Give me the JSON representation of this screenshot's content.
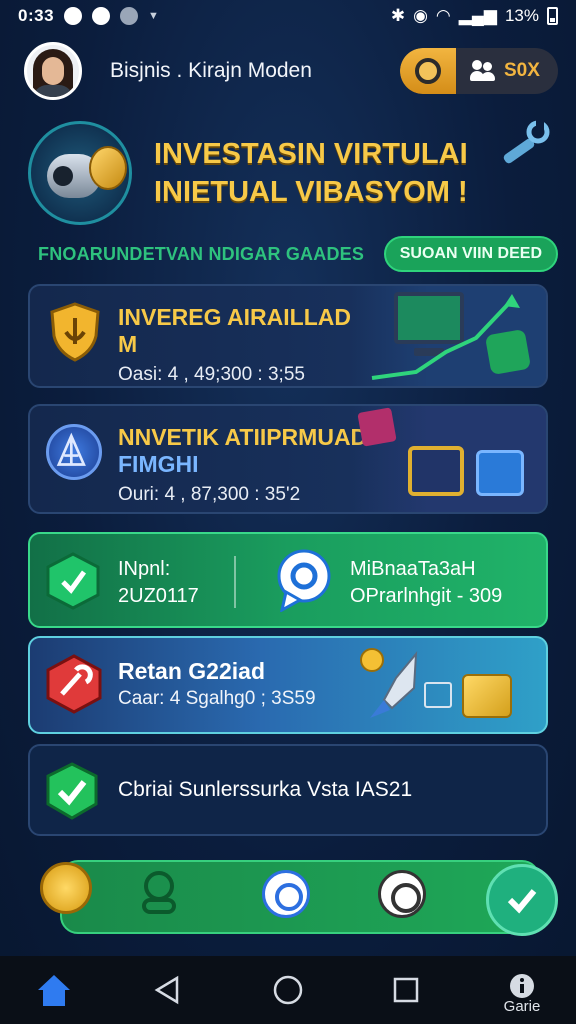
{
  "status_bar": {
    "time": "0:33",
    "battery": "13%"
  },
  "header": {
    "user_name": "Bisjnis . Kirajn Moden",
    "users_value": "S0X"
  },
  "hero": {
    "title_line1": "INVESTASIN VIRTULAI",
    "title_line2": "INIETUAL VIBASYOM !"
  },
  "subline": {
    "text": "FNOARUNDETVAN NDIGAR GAADES",
    "button": "SUOAN VIIN DEED"
  },
  "cards": [
    {
      "title_line1": "INVEREG AIRAILLAD",
      "title_line2": "M",
      "sub": "Oasi: 4 , 49;300 : 3;55"
    },
    {
      "title_line1": "NNVETIK ATIIPRMUAD",
      "title_line2": "FIMGHI",
      "sub": "Ouri: 4 , 87,300 : 35'2"
    }
  ],
  "split_card": {
    "left_line1": "INpnl:",
    "left_line2": "2UZ0117",
    "right_line1": "MiBnaaTa3aH",
    "right_line2": "OPrarlnhgit - 309"
  },
  "promo_card": {
    "title": "Retan G22iad",
    "sub": "Caar: 4 Sgalhg0 ; 3S59"
  },
  "check_card": {
    "message": "Cbriai Sunlerssurka Vsta IAS21"
  },
  "navbar": {
    "label": "Garie"
  },
  "colors": {
    "gold": "#f7c948",
    "green": "#1fa858",
    "navy": "#0b1d3d"
  },
  "icons": [
    "coin-icon",
    "users-icon",
    "wrench-icon",
    "shield-icon",
    "chart-monitor-icon",
    "blue-coin-icon",
    "cube-icon",
    "hex-shield-icon",
    "chat-bubble-icon",
    "red-hex-icon",
    "rocket-icon",
    "check-shield-icon",
    "home-icon",
    "back-icon",
    "home-circle-icon",
    "recents-icon",
    "info-icon"
  ]
}
